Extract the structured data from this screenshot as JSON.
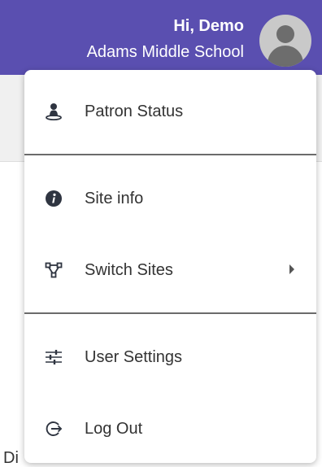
{
  "header": {
    "greeting": "Hi, Demo",
    "school": "Adams Middle School",
    "background_color": "#5a4fb0"
  },
  "menu": {
    "items": [
      {
        "label": "Patron Status",
        "icon": "patron-icon"
      },
      {
        "label": "Site info",
        "icon": "info-icon"
      },
      {
        "label": "Switch Sites",
        "icon": "network-icon",
        "has_submenu": true
      },
      {
        "label": "User Settings",
        "icon": "sliders-icon"
      },
      {
        "label": "Log Out",
        "icon": "logout-icon"
      }
    ]
  },
  "page": {
    "partial_text": "Di"
  }
}
